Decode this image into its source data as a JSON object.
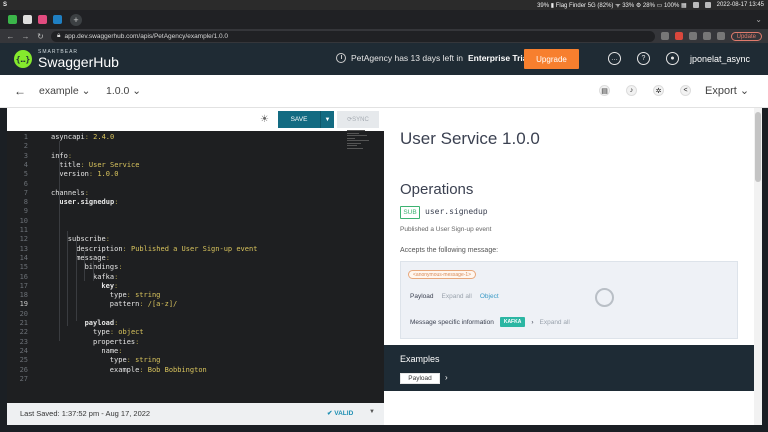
{
  "os": {
    "workspace": "S",
    "status_text": "39% ▮ Flag Finder 5G (82%) ᯤ 33% ⚙ 28% ▭ 100% ▦",
    "datetime": "2022-08-17 13:45"
  },
  "browser": {
    "url": "app.dev.swaggerhub.com/apis/PetAgency/example/1.0.0",
    "update_label": "Update"
  },
  "header": {
    "logo_small": "SMARTBEAR",
    "logo_big": "SwaggerHub",
    "trial_prefix": "PetAgency has 13 days left in",
    "trial_plan": "Enterprise Trial",
    "upgrade_label": "Upgrade",
    "username": "jponelat_async",
    "icons": [
      "chat-icon",
      "help-icon",
      "user-icon"
    ]
  },
  "toolbar": {
    "api_name": "example",
    "version": "1.0.0",
    "export_label": "Export",
    "icons": [
      "document-icon",
      "bell-icon",
      "settings-icon",
      "share-icon"
    ]
  },
  "editor": {
    "save_label": "SAVE",
    "sync_label": "SYNC",
    "lines": [
      {
        "n": "1",
        "indent": 0,
        "key": "asyncapi",
        "value": "2.4.0"
      },
      {
        "n": "2",
        "indent": 0,
        "key": "",
        "value": ""
      },
      {
        "n": "3",
        "indent": 0,
        "key": "info",
        "value": ""
      },
      {
        "n": "4",
        "indent": 1,
        "key": "title",
        "value": "User Service"
      },
      {
        "n": "5",
        "indent": 1,
        "key": "version",
        "value": "1.0.0"
      },
      {
        "n": "6",
        "indent": 0,
        "key": "",
        "value": ""
      },
      {
        "n": "7",
        "indent": 0,
        "key": "channels",
        "value": ""
      },
      {
        "n": "8",
        "indent": 1,
        "key": "user.signedup",
        "value": "",
        "bold": true
      },
      {
        "n": "9",
        "indent": 0,
        "key": "",
        "value": ""
      },
      {
        "n": "10",
        "indent": 0,
        "key": "",
        "value": ""
      },
      {
        "n": "11",
        "indent": 0,
        "key": "",
        "value": ""
      },
      {
        "n": "12",
        "indent": 2,
        "key": "subscribe",
        "value": ""
      },
      {
        "n": "13",
        "indent": 3,
        "key": "description",
        "value": "Published a User Sign-up event"
      },
      {
        "n": "14",
        "indent": 3,
        "key": "message",
        "value": ""
      },
      {
        "n": "15",
        "indent": 4,
        "key": "bindings",
        "value": ""
      },
      {
        "n": "16",
        "indent": 5,
        "key": "kafka",
        "value": ""
      },
      {
        "n": "17",
        "indent": 6,
        "key": "key",
        "value": "",
        "bold": true
      },
      {
        "n": "18",
        "indent": 7,
        "key": "type",
        "value": "string"
      },
      {
        "n": "19",
        "indent": 7,
        "key": "pattern",
        "value": "/[a-z]/",
        "current": true
      },
      {
        "n": "20",
        "indent": 0,
        "key": "",
        "value": ""
      },
      {
        "n": "21",
        "indent": 4,
        "key": "payload",
        "value": "",
        "bold": true
      },
      {
        "n": "22",
        "indent": 5,
        "key": "type",
        "value": "object"
      },
      {
        "n": "23",
        "indent": 5,
        "key": "properties",
        "value": ""
      },
      {
        "n": "24",
        "indent": 6,
        "key": "name",
        "value": ""
      },
      {
        "n": "25",
        "indent": 7,
        "key": "type",
        "value": "string"
      },
      {
        "n": "26",
        "indent": 7,
        "key": "example",
        "value": "Bob Bobbington"
      },
      {
        "n": "27",
        "indent": 0,
        "key": "",
        "value": ""
      }
    ],
    "last_saved": "Last Saved:  1:37:52 pm  -  Aug 17, 2022",
    "valid_label": "✔ VALID"
  },
  "doc": {
    "title": "User Service 1.0.0",
    "operations_label": "Operations",
    "op_badge": "SUB",
    "channel": "user.signedup",
    "description": "Published a User Sign-up event",
    "accepts_label": "Accepts the following message:",
    "anon_message": "<anonymous-message-1>",
    "payload_label": "Payload",
    "expand_all": "Expand all",
    "object_label": "Object",
    "meta_label": "Message specific information",
    "kafka_label": "KAFKA",
    "examples_label": "Examples",
    "examples_chip": "Payload"
  }
}
